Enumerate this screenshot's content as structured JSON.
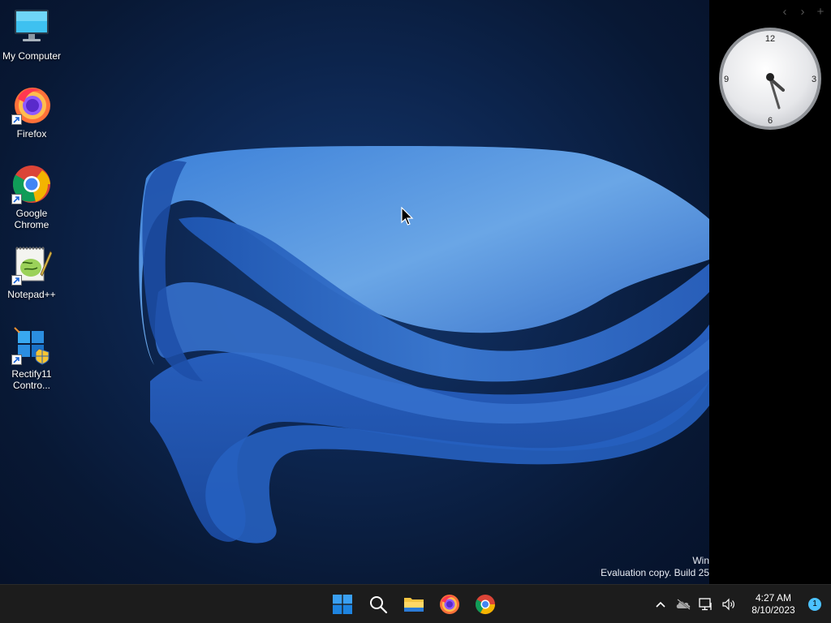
{
  "desktop": {
    "icons": [
      {
        "label": "My Computer",
        "icon": "monitor-icon",
        "shortcut": false
      },
      {
        "label": "Firefox",
        "icon": "firefox-icon",
        "shortcut": true
      },
      {
        "label": "Google Chrome",
        "icon": "chrome-icon",
        "shortcut": true
      },
      {
        "label": "Notepad++",
        "icon": "notepad-plus-plus-icon",
        "shortcut": true
      },
      {
        "label": "Rectify11 Contro...",
        "icon": "rectify11-control-panel-icon",
        "shortcut": true
      }
    ],
    "watermark": {
      "line1": "Win",
      "line2": "Evaluation copy. Build 25"
    }
  },
  "gadgets": {
    "controls": [
      "‹",
      "›",
      "+"
    ],
    "clock": {
      "numerals": [
        "12",
        "3",
        "6",
        "9"
      ],
      "time": "4:27"
    }
  },
  "taskbar": {
    "pinned": [
      "start-icon",
      "search-icon",
      "file-explorer-icon",
      "firefox-icon",
      "chrome-icon"
    ],
    "tray": {
      "time": "4:27 AM",
      "date": "8/10/2023",
      "notification_count": "1"
    }
  },
  "colors": {
    "taskbar_bg": "#1c1c1c",
    "accent": "#4cc2ff",
    "wallpaper_blue": "#2f6fd0"
  }
}
